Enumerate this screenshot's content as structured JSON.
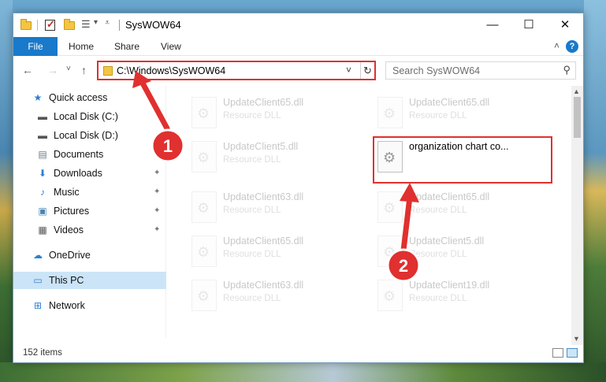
{
  "window": {
    "title": "SysWOW64",
    "controls": {
      "minimize": "—",
      "maximize": "☐",
      "close": "✕"
    }
  },
  "ribbon": {
    "tabs": [
      "File",
      "Home",
      "Share",
      "View"
    ],
    "collapse_glyph": "˄",
    "help_glyph": "?"
  },
  "nav": {
    "back": "←",
    "forward": "→",
    "recent": "˅",
    "up": "↑",
    "address": "C:\\Windows\\SysWOW64",
    "address_dropdown": "˅",
    "refresh": "↻",
    "search_placeholder": "Search SysWOW64",
    "search_glyph": "⚲"
  },
  "sidebar": {
    "items": [
      {
        "label": "Quick access",
        "icon": "star-icon",
        "glyph": "★",
        "color": "#2f7fd0"
      },
      {
        "label": "Local Disk (C:)",
        "icon": "drive-icon",
        "glyph": "▬",
        "color": "#555555"
      },
      {
        "label": "Local Disk (D:)",
        "icon": "drive-icon",
        "glyph": "▬",
        "color": "#555555"
      },
      {
        "label": "Documents",
        "icon": "documents-icon",
        "glyph": "▤",
        "color": "#6b7a8a"
      },
      {
        "label": "Downloads",
        "icon": "downloads-icon",
        "glyph": "⬇",
        "color": "#2f7fd0"
      },
      {
        "label": "Music",
        "icon": "music-icon",
        "glyph": "♪",
        "color": "#2f7fd0"
      },
      {
        "label": "Pictures",
        "icon": "pictures-icon",
        "glyph": "▣",
        "color": "#4a86b0"
      },
      {
        "label": "Videos",
        "icon": "videos-icon",
        "glyph": "▦",
        "color": "#555555"
      },
      {
        "label": "OneDrive",
        "icon": "cloud-icon",
        "glyph": "☁",
        "color": "#2f7fd0"
      },
      {
        "label": "This PC",
        "icon": "computer-icon",
        "glyph": "▭",
        "color": "#2f7fd0"
      },
      {
        "label": "Network",
        "icon": "network-icon",
        "glyph": "⊞",
        "color": "#2f7fd0"
      }
    ],
    "pin_glyph": "✦"
  },
  "files": [
    {
      "name": "UpdateClient65.dll",
      "type": "Resource DLL"
    },
    {
      "name": "UpdateClient65.dll",
      "type": "Resource DLL"
    },
    {
      "name": "UpdateClient5.dll",
      "type": "Resource DLL"
    },
    {
      "name": "organization chart co...",
      "type": ""
    },
    {
      "name": "UpdateClient63.dll",
      "type": "Resource DLL"
    },
    {
      "name": "UpdateClient65.dll",
      "type": "Resource DLL"
    },
    {
      "name": "UpdateClient65.dll",
      "type": "Resource DLL"
    },
    {
      "name": "UpdateClient5.dll",
      "type": "Resource DLL"
    },
    {
      "name": "UpdateClient63.dll",
      "type": "Resource DLL"
    },
    {
      "name": "UpdateClient19.dll",
      "type": "Resource DLL"
    }
  ],
  "status": {
    "items": "152 items"
  },
  "annotations": {
    "step1": "1",
    "step2": "2",
    "color": "#e0302f"
  }
}
